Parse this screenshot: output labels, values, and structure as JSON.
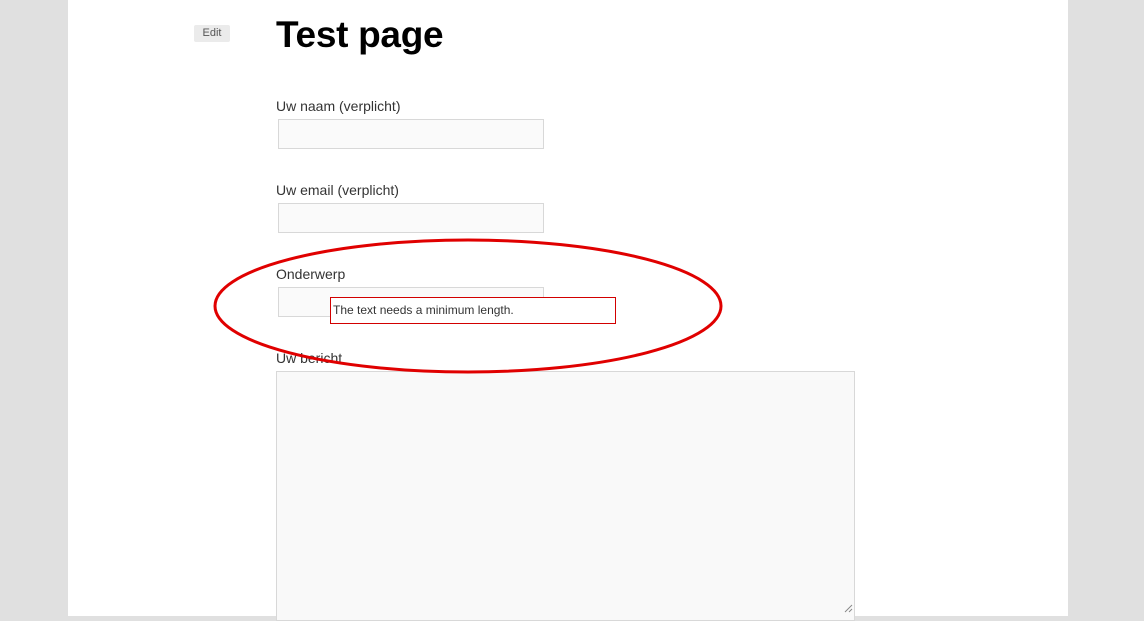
{
  "page": {
    "title": "Test page",
    "edit_label": "Edit"
  },
  "form": {
    "name_label": "Uw naam (verplicht)",
    "name_value": "",
    "email_label": "Uw email (verplicht)",
    "email_value": "",
    "subject_label": "Onderwerp",
    "subject_value": "",
    "message_label": "Uw bericht",
    "message_value": ""
  },
  "validation": {
    "message": "The text needs a minimum length."
  },
  "colors": {
    "background": "#e0e0e0",
    "content": "#ffffff",
    "annotation": "#e00000",
    "tooltip_border": "#d20000"
  }
}
